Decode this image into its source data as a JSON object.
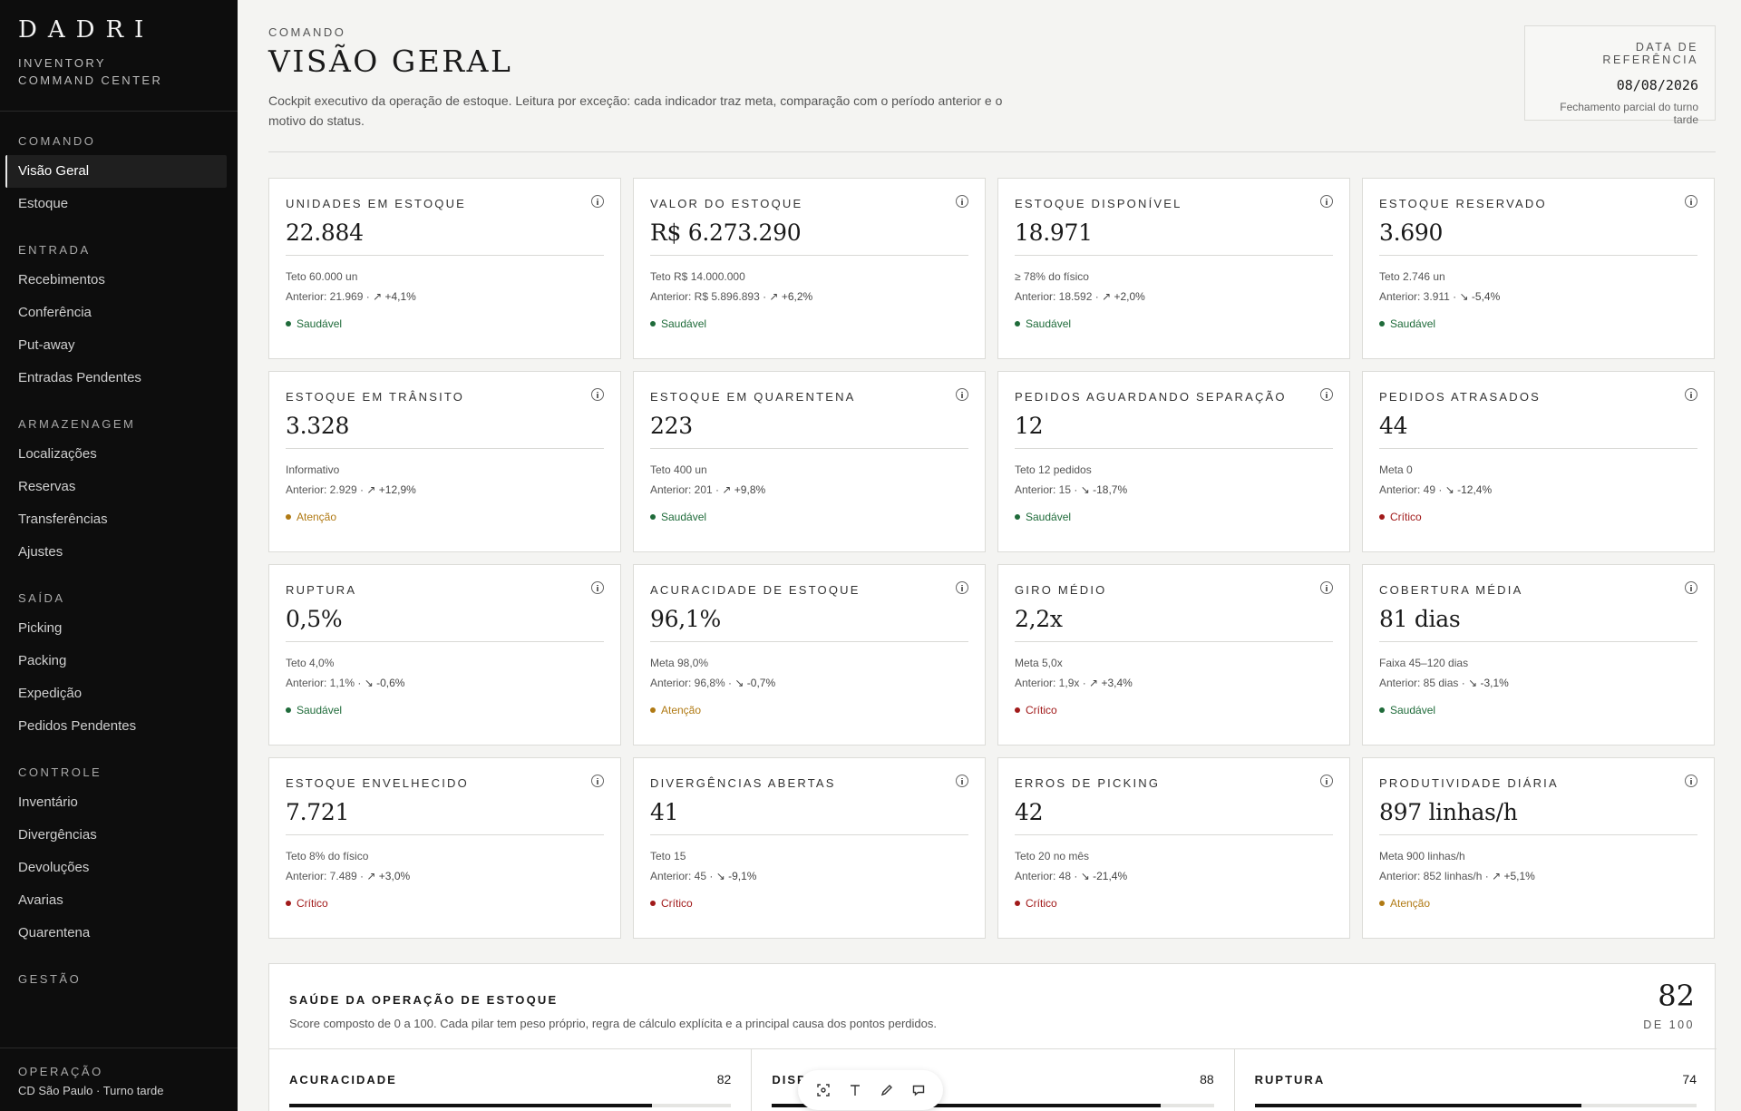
{
  "brand": {
    "logo": "DADRI",
    "subtitle_line1": "INVENTORY",
    "subtitle_line2": "COMMAND CENTER"
  },
  "sidebar": {
    "groups": [
      {
        "title": "COMANDO",
        "items": [
          {
            "label": "Visão Geral",
            "active": true
          },
          {
            "label": "Estoque"
          }
        ]
      },
      {
        "title": "ENTRADA",
        "items": [
          {
            "label": "Recebimentos"
          },
          {
            "label": "Conferência"
          },
          {
            "label": "Put-away"
          },
          {
            "label": "Entradas Pendentes"
          }
        ]
      },
      {
        "title": "ARMAZENAGEM",
        "items": [
          {
            "label": "Localizações"
          },
          {
            "label": "Reservas"
          },
          {
            "label": "Transferências"
          },
          {
            "label": "Ajustes"
          }
        ]
      },
      {
        "title": "SAÍDA",
        "items": [
          {
            "label": "Picking"
          },
          {
            "label": "Packing"
          },
          {
            "label": "Expedição"
          },
          {
            "label": "Pedidos Pendentes"
          }
        ]
      },
      {
        "title": "CONTROLE",
        "items": [
          {
            "label": "Inventário"
          },
          {
            "label": "Divergências"
          },
          {
            "label": "Devoluções"
          },
          {
            "label": "Avarias"
          },
          {
            "label": "Quarentena"
          }
        ]
      },
      {
        "title": "GESTÃO",
        "items": []
      }
    ],
    "footer": {
      "title": "OPERAÇÃO",
      "text": "CD São Paulo · Turno tarde"
    }
  },
  "header": {
    "eyebrow": "COMANDO",
    "title": "VISÃO GERAL",
    "description": "Cockpit executivo da operação de estoque. Leitura por exceção: cada indicador traz meta, comparação com o período anterior e o motivo do status.",
    "reference": {
      "title": "DATA DE REFERÊNCIA",
      "date": "08/08/2026",
      "note": "Fechamento parcial do turno tarde"
    }
  },
  "colors": {
    "ok": "#1f6b3a",
    "warn": "#b07a14",
    "crit": "#a11a1a"
  },
  "kpis": [
    {
      "title": "UNIDADES EM ESTOQUE",
      "value": "22.884",
      "target": "Teto 60.000 un",
      "prev": "Anterior: 21.969 ·",
      "trend_icon": "↗",
      "trend": "+4,1%",
      "status": "Saudável",
      "level": "ok"
    },
    {
      "title": "VALOR DO ESTOQUE",
      "value": "R$ 6.273.290",
      "target": "Teto R$ 14.000.000",
      "prev": "Anterior: R$ 5.896.893 ·",
      "trend_icon": "↗",
      "trend": "+6,2%",
      "status": "Saudável",
      "level": "ok"
    },
    {
      "title": "ESTOQUE DISPONÍVEL",
      "value": "18.971",
      "target": "≥ 78% do físico",
      "prev": "Anterior: 18.592 ·",
      "trend_icon": "↗",
      "trend": "+2,0%",
      "status": "Saudável",
      "level": "ok"
    },
    {
      "title": "ESTOQUE RESERVADO",
      "value": "3.690",
      "target": "Teto 2.746 un",
      "prev": "Anterior: 3.911 ·",
      "trend_icon": "↘",
      "trend": "-5,4%",
      "status": "Saudável",
      "level": "ok"
    },
    {
      "title": "ESTOQUE EM TRÂNSITO",
      "value": "3.328",
      "target": "Informativo",
      "prev": "Anterior: 2.929 ·",
      "trend_icon": "↗",
      "trend": "+12,9%",
      "status": "Atenção",
      "level": "warn"
    },
    {
      "title": "ESTOQUE EM QUARENTENA",
      "value": "223",
      "target": "Teto 400 un",
      "prev": "Anterior: 201 ·",
      "trend_icon": "↗",
      "trend": "+9,8%",
      "status": "Saudável",
      "level": "ok"
    },
    {
      "title": "PEDIDOS AGUARDANDO SEPARAÇÃO",
      "value": "12",
      "target": "Teto 12 pedidos",
      "prev": "Anterior: 15 ·",
      "trend_icon": "↘",
      "trend": "-18,7%",
      "status": "Saudável",
      "level": "ok"
    },
    {
      "title": "PEDIDOS ATRASADOS",
      "value": "44",
      "target": "Meta 0",
      "prev": "Anterior: 49 ·",
      "trend_icon": "↘",
      "trend": "-12,4%",
      "status": "Crítico",
      "level": "crit"
    },
    {
      "title": "RUPTURA",
      "value": "0,5%",
      "target": "Teto 4,0%",
      "prev": "Anterior: 1,1% ·",
      "trend_icon": "↘",
      "trend": "-0,6%",
      "status": "Saudável",
      "level": "ok"
    },
    {
      "title": "ACURACIDADE DE ESTOQUE",
      "value": "96,1%",
      "target": "Meta 98,0%",
      "prev": "Anterior: 96,8% ·",
      "trend_icon": "↘",
      "trend": "-0,7%",
      "status": "Atenção",
      "level": "warn"
    },
    {
      "title": "GIRO MÉDIO",
      "value": "2,2x",
      "target": "Meta 5,0x",
      "prev": "Anterior: 1,9x ·",
      "trend_icon": "↗",
      "trend": "+3,4%",
      "status": "Crítico",
      "level": "crit"
    },
    {
      "title": "COBERTURA MÉDIA",
      "value": "81 dias",
      "target": "Faixa 45–120 dias",
      "prev": "Anterior: 85 dias ·",
      "trend_icon": "↘",
      "trend": "-3,1%",
      "status": "Saudável",
      "level": "ok"
    },
    {
      "title": "ESTOQUE ENVELHECIDO",
      "value": "7.721",
      "target": "Teto 8% do físico",
      "prev": "Anterior: 7.489 ·",
      "trend_icon": "↗",
      "trend": "+3,0%",
      "status": "Crítico",
      "level": "crit"
    },
    {
      "title": "DIVERGÊNCIAS ABERTAS",
      "value": "41",
      "target": "Teto 15",
      "prev": "Anterior: 45 ·",
      "trend_icon": "↘",
      "trend": "-9,1%",
      "status": "Crítico",
      "level": "crit"
    },
    {
      "title": "ERROS DE PICKING",
      "value": "42",
      "target": "Teto 20 no mês",
      "prev": "Anterior: 48 ·",
      "trend_icon": "↘",
      "trend": "-21,4%",
      "status": "Crítico",
      "level": "crit"
    },
    {
      "title": "PRODUTIVIDADE DIÁRIA",
      "value": "897 linhas/h",
      "target": "Meta 900 linhas/h",
      "prev": "Anterior: 852 linhas/h ·",
      "trend_icon": "↗",
      "trend": "+5,1%",
      "status": "Atenção",
      "level": "warn"
    }
  ],
  "health": {
    "title": "SAÚDE DA OPERAÇÃO DE ESTOQUE",
    "description": "Score composto de 0 a 100. Cada pilar tem peso próprio, regra de cálculo explícita e a principal causa dos pontos perdidos.",
    "score": "82",
    "of": "DE 100",
    "pillars": [
      {
        "name": "ACURACIDADE",
        "value": "82",
        "percent": 82
      },
      {
        "name": "DISP",
        "value": "88",
        "percent": 88
      },
      {
        "name": "RUPTURA",
        "value": "74",
        "percent": 74
      }
    ]
  }
}
